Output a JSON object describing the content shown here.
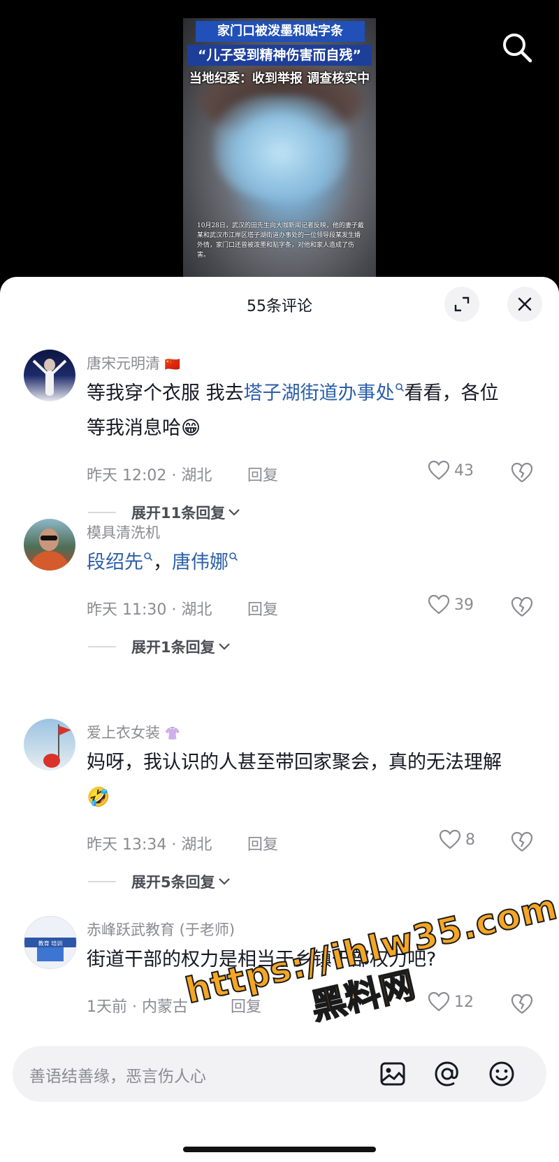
{
  "video": {
    "banner_line1": "家门口被泼墨和贴字条",
    "banner_line2": "“儿子受到精神伤害而自残”",
    "banner_line3": "当地纪委：收到举报 调查核实中",
    "caption": "10月28日，武汉的田先生向大咖新闻记者反映，他的妻子戴某和武汉市江岸区塔子湖街道办事处的一位领导段某发生婚外情，家门口还曾被泼墨和贴字条，对他和家人造成了伤害。"
  },
  "sheet": {
    "title": "55条评论",
    "expand_icon": "expand-icon",
    "close_icon": "close-icon"
  },
  "comments": [
    {
      "username": "唐宋元明清",
      "badge": "🇨🇳",
      "text_pre": "等我穿个衣服 我去",
      "link1": "塔子湖街道办事处",
      "text_post": "看看，各位 等我消息哈",
      "emoji": "😁",
      "time_loc": "昨天 12:02 · 湖北",
      "reply": "回复",
      "likes": "43",
      "expand": "展开11条回复"
    },
    {
      "username": "模具清洗机",
      "link1": "段绍先",
      "sep": "，",
      "link2": "唐伟娜",
      "time_loc": "昨天 11:30 · 湖北",
      "reply": "回复",
      "likes": "39",
      "expand": "展开1条回复"
    },
    {
      "username": "爱上衣女装",
      "badge": "👚",
      "text": "妈呀，我认识的人甚至带回家聚会，真的无法理解",
      "emoji": "🤣",
      "time_loc": "昨天 13:34 · 湖北",
      "reply": "回复",
      "likes": "8",
      "expand": "展开5条回复"
    },
    {
      "username": "赤峰跃武教育 (于老师)",
      "avatar_text": "教育 培训",
      "text": "街道干部的权力是相当于乡镇干部权力吧?",
      "time_loc": "1天前 · 内蒙古",
      "reply": "回复",
      "likes": "12"
    }
  ],
  "input": {
    "placeholder": "善语结善缘，恶言伤人心"
  },
  "watermark": {
    "line1": "https://ihlw35.com",
    "line2": "黑料网"
  },
  "colors": {
    "link": "#2b5fa8",
    "meta": "#8a8b91",
    "watermark": "#f5a623"
  }
}
